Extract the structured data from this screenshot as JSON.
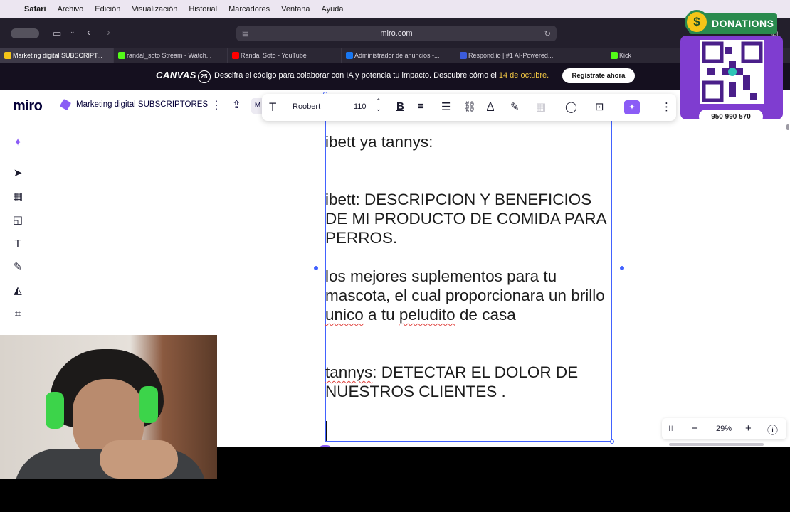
{
  "menubar": {
    "app": "Safari",
    "items": [
      "Archivo",
      "Edición",
      "Visualización",
      "Historial",
      "Marcadores",
      "Ventana",
      "Ayuda"
    ]
  },
  "safari": {
    "url": "miro.com"
  },
  "tabs": [
    {
      "label": "Marketing digital SUBSCRIPT...",
      "color": "#f5c518"
    },
    {
      "label": "randal_soto Stream - Watch...",
      "color": "#53fc18"
    },
    {
      "label": "Randal Soto - YouTube",
      "color": "#ff0000"
    },
    {
      "label": "Administrador de anuncios -...",
      "color": "#1877f2"
    },
    {
      "label": "Respond.io | #1 AI-Powered...",
      "color": "#3b5bdb"
    },
    {
      "label": "Kick",
      "color": "#53fc18"
    }
  ],
  "banner": {
    "logo": "CANVAS",
    "logo_badge": "25",
    "message": "Descifra el código para colaborar con IA y potencia tu impacto. Descubre cómo el",
    "highlight": "14 de octubre.",
    "cta": "Regístrate ahora"
  },
  "miro": {
    "logo": "miro",
    "board_name": "Marketing digital SUBSCRIPTORES",
    "board_chip": "M",
    "toolbar": {
      "font": "Roobert",
      "size": "110"
    },
    "text": {
      "line1": "ibett ya tannys:",
      "p2": "ibett: DESCRIPCION Y BENEFICIOS DE MI PRODUCTO DE COMIDA PARA PERROS.",
      "p3_a": "los mejores suplementos para tu mascota, el cual proporcionara un brillo ",
      "p3_b": "unico",
      "p3_c": " a tu ",
      "p3_d": "peludito",
      "p3_e": " de casa",
      "p4_a": "tannys",
      "p4_b": ": DETECTAR EL DOLOR DE NUESTROS CLIENTES ."
    },
    "zoom": "29%"
  },
  "donations": {
    "title": "DONATIONS",
    "coin": "$",
    "phone": "950 990 570"
  }
}
